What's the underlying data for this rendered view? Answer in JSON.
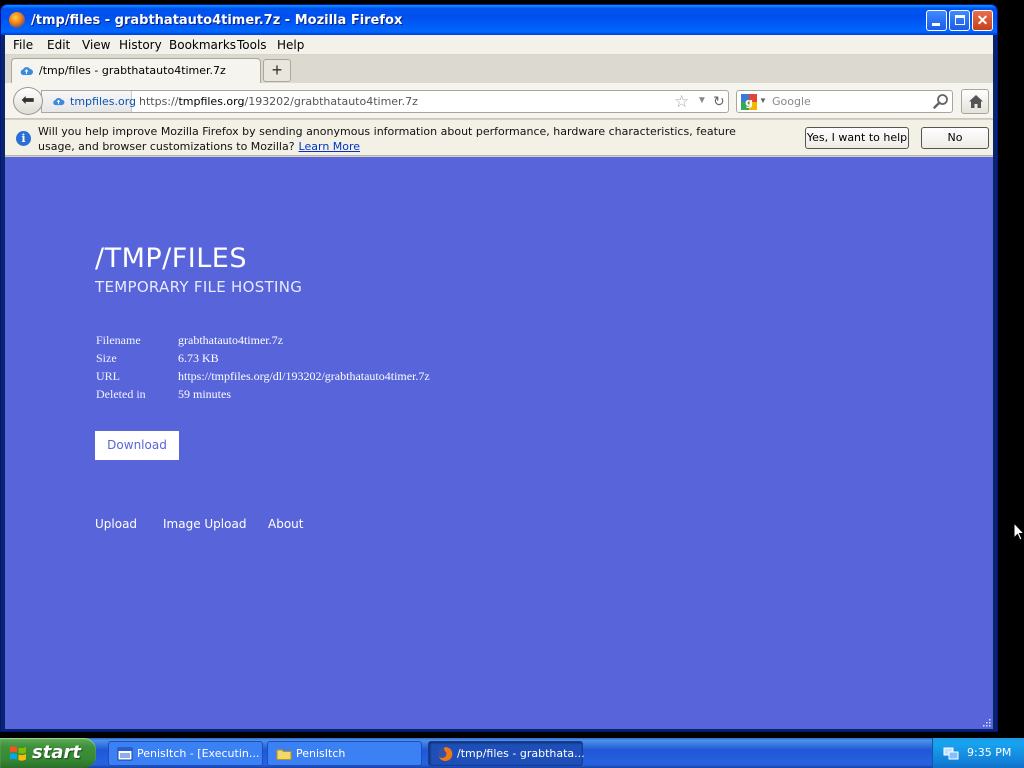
{
  "window": {
    "title": "/tmp/files - grabthatauto4timer.7z - Mozilla Firefox"
  },
  "menubar": {
    "items": [
      "File",
      "Edit",
      "View",
      "History",
      "Bookmarks",
      "Tools",
      "Help"
    ]
  },
  "tabs": [
    {
      "label": "/tmp/files - grabthatauto4timer.7z"
    }
  ],
  "navbar": {
    "identity_label": "tmpfiles.org",
    "url_prefix": "https://",
    "url_host": "tmpfiles.org",
    "url_path": "/193202/grabthatauto4timer.7z",
    "search_placeholder": "Google"
  },
  "notification": {
    "message": "Will you help improve Mozilla Firefox by sending anonymous information about performance, hardware characteristics, feature usage, and browser customizations to Mozilla?",
    "link_label": "Learn More",
    "yes_button": "Yes, I want to help",
    "no_button": "No"
  },
  "page": {
    "title": "/TMP/FILES",
    "subtitle": "TEMPORARY FILE HOSTING",
    "details": [
      {
        "key": "Filename",
        "value": "grabthatauto4timer.7z"
      },
      {
        "key": "Size",
        "value": "6.73 KB"
      },
      {
        "key": "URL",
        "value": "https://tmpfiles.org/dl/193202/grabthatauto4timer.7z"
      },
      {
        "key": "Deleted in",
        "value": "59 minutes"
      }
    ],
    "download_label": "Download",
    "footer_links": [
      "Upload",
      "Image Upload",
      "About"
    ],
    "background_color": "#5865da"
  },
  "taskbar": {
    "start_label": "start",
    "tasks": [
      {
        "label": "PenisItch - [Executin...",
        "icon": "app-window-icon",
        "active": false
      },
      {
        "label": "PenisItch",
        "icon": "folder-icon",
        "active": false
      },
      {
        "label": "/tmp/files - grabthata...",
        "icon": "firefox-icon",
        "active": true
      }
    ],
    "clock": "9:35 PM"
  }
}
